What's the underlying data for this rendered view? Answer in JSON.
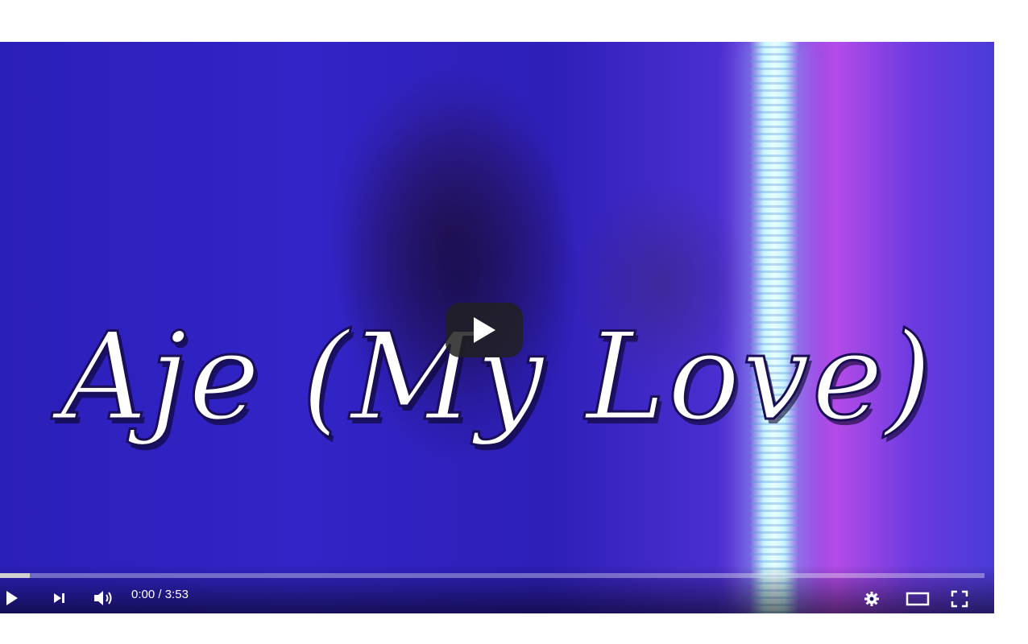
{
  "video": {
    "title_overlay": "Aje (My Love)"
  },
  "controls": {
    "current_time": "0:00",
    "separator": " / ",
    "duration": "3:53",
    "progress_fraction": 0.03
  },
  "icons": {
    "big_play": "play-icon",
    "play": "play-icon",
    "next": "next-icon",
    "volume": "volume-icon",
    "settings": "gear-icon",
    "theater": "theater-mode-icon",
    "fullscreen": "fullscreen-icon"
  },
  "colors": {
    "big_play_bg": "#212121",
    "progress_track": "#ffffff",
    "progress_fill": "#d0d0d0",
    "control_icons": "#ffffff"
  }
}
